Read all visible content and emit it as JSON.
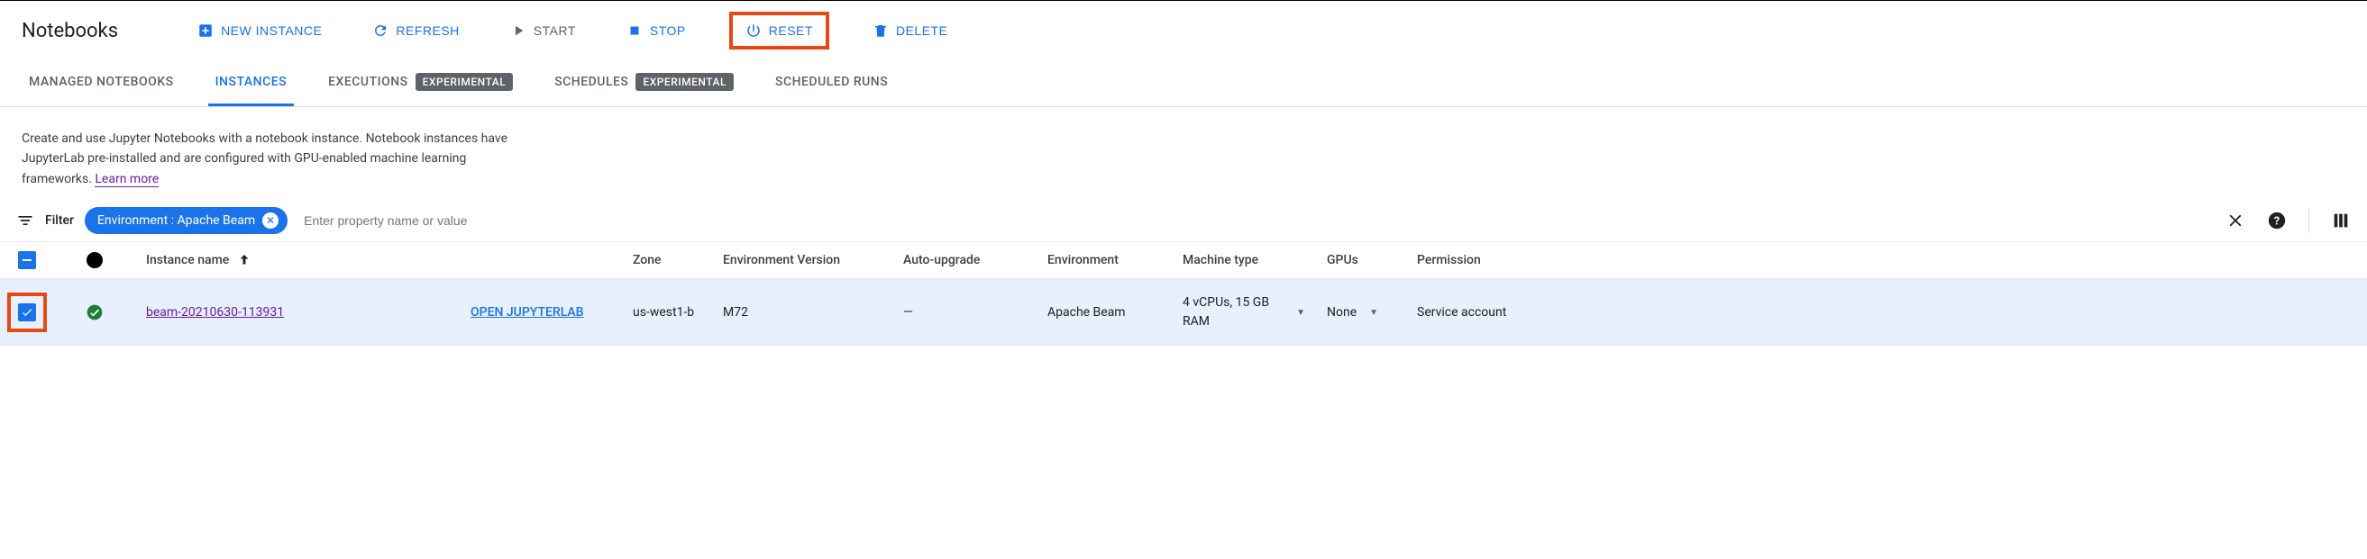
{
  "page_title": "Notebooks",
  "toolbar": {
    "new_instance": "NEW INSTANCE",
    "refresh": "REFRESH",
    "start": "START",
    "stop": "STOP",
    "reset": "RESET",
    "delete": "DELETE"
  },
  "tabs": {
    "managed": "MANAGED NOTEBOOKS",
    "instances": "INSTANCES",
    "executions": "EXECUTIONS",
    "executions_badge": "EXPERIMENTAL",
    "schedules": "SCHEDULES",
    "schedules_badge": "EXPERIMENTAL",
    "scheduled_runs": "SCHEDULED RUNS"
  },
  "description": "Create and use Jupyter Notebooks with a notebook instance. Notebook instances have JupyterLab pre-installed and are configured with GPU-enabled machine learning frameworks. ",
  "learn_more": "Learn more",
  "filter": {
    "label": "Filter",
    "chip": "Environment : Apache Beam",
    "placeholder": "Enter property name or value"
  },
  "columns": {
    "instance_name": "Instance name",
    "zone": "Zone",
    "env_version": "Environment Version",
    "auto_upgrade": "Auto-upgrade",
    "environment": "Environment",
    "machine_type": "Machine type",
    "gpus": "GPUs",
    "permission": "Permission"
  },
  "rows": [
    {
      "name": "beam-20210630-113931",
      "open": "OPEN JUPYTERLAB",
      "zone": "us-west1-b",
      "env_version": "M72",
      "auto_upgrade": "—",
      "environment": "Apache Beam",
      "machine_type": "4 vCPUs, 15 GB RAM",
      "gpus": "None",
      "permission": "Service account"
    }
  ]
}
